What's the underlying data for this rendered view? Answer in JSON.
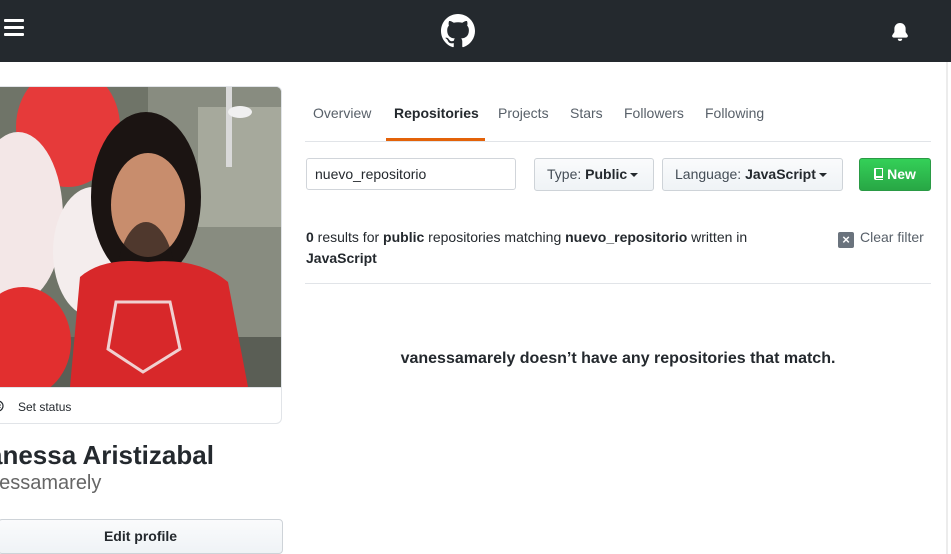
{
  "header": {
    "logo_icon": "github-mark-icon",
    "menu_icon": "hamburger-icon",
    "notifications_icon": "bell-icon"
  },
  "profile": {
    "set_status_label": "Set status",
    "full_name": "anessa Aristizabal",
    "username": "nessamarely",
    "edit_profile_label": "Edit profile"
  },
  "tabs": [
    {
      "label": "Overview",
      "active": false
    },
    {
      "label": "Repositories",
      "active": true
    },
    {
      "label": "Projects",
      "active": false
    },
    {
      "label": "Stars",
      "active": false
    },
    {
      "label": "Followers",
      "active": false
    },
    {
      "label": "Following",
      "active": false
    }
  ],
  "filters": {
    "search_value": "nuevo_repositorio",
    "type_prefix": "Type:",
    "type_value": "Public",
    "language_prefix": "Language:",
    "language_value": "JavaScript",
    "new_label": "New"
  },
  "results": {
    "count": "0",
    "text_1": " results for ",
    "visibility": "public",
    "text_2": " repositories matching ",
    "query": "nuevo_repositorio",
    "text_3": " written in",
    "language": "JavaScript",
    "clear_filter_label": "Clear filter",
    "blankslate": "vanessamarely doesn’t have any repositories that match."
  },
  "colors": {
    "header_bg": "#24292e",
    "tab_underline": "#e36209",
    "new_button": "#2ea44f"
  }
}
